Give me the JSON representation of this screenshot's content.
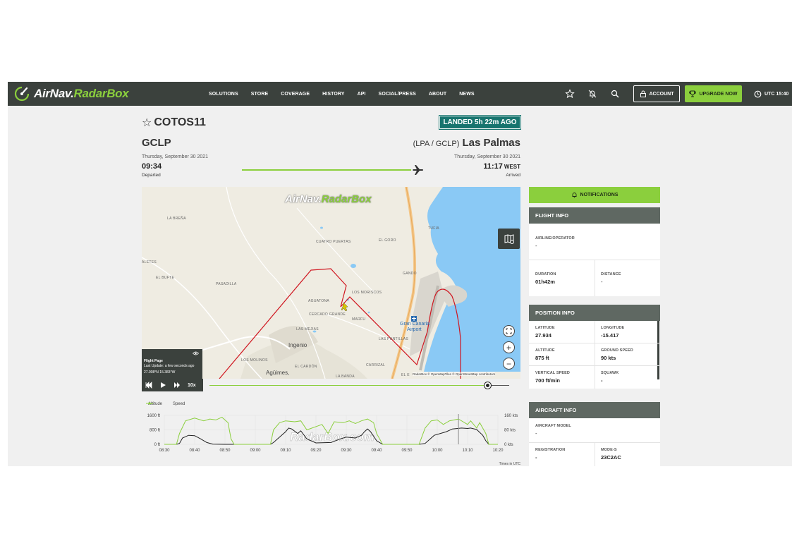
{
  "nav": {
    "brand_main": "AirNav",
    "brand_accent": "RadarBox",
    "menu": [
      "SOLUTIONS",
      "STORE",
      "COVERAGE",
      "HISTORY",
      "API",
      "SOCIAL/PRESS",
      "ABOUT",
      "NEWS"
    ],
    "account": "ACCOUNT",
    "upgrade": "UPGRADE NOW",
    "utc": "UTC 15:40"
  },
  "flight": {
    "callsign": "COTOS11",
    "status": "LANDED 5h 22m AGO",
    "origin_code": "GCLP",
    "dest_codes": "(LPA / GCLP)",
    "dest_city": "Las Palmas",
    "dep_date": "Thursday, September 30 2021",
    "arr_date": "Thursday, September 30 2021",
    "dep_time": "09:34",
    "arr_time": "11:17",
    "arr_tz": "WEST",
    "dep_state": "Departed",
    "arr_state": "Arrived"
  },
  "map": {
    "watermark_main": "AirNav",
    "watermark_accent": "RadarBox",
    "labels": [
      "LA BREÑA",
      "CUATRO PUERTAS",
      "EL GORO",
      "TUFIA",
      "ALETES",
      "EL BUFTE",
      "PASADILLA",
      "GANDO",
      "LOS MORISCOS",
      "AGUATONA",
      "CERCADO GRANDE",
      "MARFU",
      "LAS MEJIAS",
      "LAS PUNTILLAS",
      "LOS MOLINOS",
      "EL CARDÓN",
      "CARRIZAL",
      "LA BANDA",
      "EL E"
    ],
    "towns": [
      "Ingenio",
      "Agüimes,",
      "Gran Canaria",
      "Airport"
    ],
    "attribution": "RadarBox © OpenMapTiles © OpenStreetMap contributors",
    "info_title": "Flight Page",
    "info_update": "Last Update: a few seconds ago",
    "info_coords": "27.908°N 15.383°W",
    "playback_speed": "10x"
  },
  "chart_data": {
    "type": "line",
    "legend": [
      "Altitude",
      "Speed"
    ],
    "x": [
      "08:30",
      "08:40",
      "08:50",
      "09:00",
      "09:10",
      "09:20",
      "09:30",
      "09:40",
      "09:50",
      "10:00",
      "10:10",
      "10:20"
    ],
    "y_left_ticks": [
      "1600 ft",
      "800 ft",
      "0 ft"
    ],
    "y_right_ticks": [
      "160 kts",
      "80 kts",
      "0 kts"
    ],
    "y_left_range": [
      0,
      1600
    ],
    "y_right_range": [
      0,
      160
    ],
    "xlabel": "Times in UTC",
    "watermark": "RadarBox.com",
    "series": [
      {
        "name": "Altitude",
        "color": "#222222",
        "points": [
          [
            0,
            0
          ],
          [
            4,
            0
          ],
          [
            5,
            50
          ],
          [
            6,
            350
          ],
          [
            8,
            500
          ],
          [
            10,
            480
          ],
          [
            12,
            300
          ],
          [
            14,
            100
          ],
          [
            16,
            10
          ],
          [
            20,
            0
          ],
          [
            35,
            0
          ],
          [
            36,
            100
          ],
          [
            38,
            400
          ],
          [
            40,
            700
          ],
          [
            41,
            900
          ],
          [
            42,
            850
          ],
          [
            44,
            600
          ],
          [
            45,
            750
          ],
          [
            47,
            300
          ],
          [
            50,
            80
          ],
          [
            55,
            100
          ],
          [
            58,
            300
          ],
          [
            60,
            400
          ],
          [
            63,
            350
          ],
          [
            65,
            500
          ],
          [
            66,
            700
          ],
          [
            67,
            850
          ],
          [
            68,
            700
          ],
          [
            70,
            200
          ],
          [
            72,
            0
          ],
          [
            84,
            0
          ],
          [
            86,
            50
          ],
          [
            89,
            500
          ],
          [
            93,
            700
          ],
          [
            95,
            850
          ],
          [
            98,
            900
          ],
          [
            100,
            880
          ],
          [
            101,
            900
          ],
          [
            103,
            820
          ],
          [
            105,
            500
          ],
          [
            106,
            200
          ],
          [
            107,
            0
          ],
          [
            110,
            0
          ]
        ]
      },
      {
        "name": "Speed",
        "color": "#8bcf3d",
        "points": [
          [
            0,
            0
          ],
          [
            4,
            0
          ],
          [
            5,
            60
          ],
          [
            7,
            130
          ],
          [
            10,
            145
          ],
          [
            13,
            130
          ],
          [
            15,
            140
          ],
          [
            17,
            135
          ],
          [
            19,
            150
          ],
          [
            21,
            120
          ],
          [
            22,
            30
          ],
          [
            23,
            0
          ],
          [
            35,
            0
          ],
          [
            36,
            80
          ],
          [
            38,
            120
          ],
          [
            40,
            130
          ],
          [
            43,
            125
          ],
          [
            45,
            130
          ],
          [
            47,
            80
          ],
          [
            52,
            110
          ],
          [
            54,
            60
          ],
          [
            56,
            125
          ],
          [
            59,
            120
          ],
          [
            61,
            130
          ],
          [
            63,
            115
          ],
          [
            65,
            130
          ],
          [
            67,
            140
          ],
          [
            69,
            120
          ],
          [
            70,
            60
          ],
          [
            72,
            0
          ],
          [
            84,
            0
          ],
          [
            86,
            90
          ],
          [
            88,
            130
          ],
          [
            90,
            135
          ],
          [
            92,
            110
          ],
          [
            94,
            130
          ],
          [
            97,
            140
          ],
          [
            100,
            110
          ],
          [
            101,
            130
          ],
          [
            103,
            90
          ],
          [
            104,
            120
          ],
          [
            106,
            60
          ],
          [
            107,
            0
          ],
          [
            110,
            0
          ]
        ]
      }
    ]
  },
  "panel": {
    "notifications": "NOTIFICATIONS",
    "flight_info": {
      "title": "FLIGHT INFO",
      "airline_k": "AIRLINE/OPERATOR",
      "airline_v": "-",
      "duration_k": "DURATION",
      "duration_v": "01h42m",
      "distance_k": "DISTANCE",
      "distance_v": "-"
    },
    "position_info": {
      "title": "POSITION INFO",
      "lat_k": "LATITUDE",
      "lat_v": "27.934",
      "lon_k": "LONGITUDE",
      "lon_v": "-15.417",
      "alt_k": "ALTITUDE",
      "alt_v": "875 ft",
      "gs_k": "GROUND SPEED",
      "gs_v": "90 kts",
      "vs_k": "VERTICAL SPEED",
      "vs_v": "700 ft/min",
      "sq_k": "SQUAWK",
      "sq_v": "-"
    },
    "aircraft_info": {
      "title": "AIRCRAFT INFO",
      "model_k": "AIRCRAFT MODEL",
      "model_v": "-",
      "reg_k": "REGISTRATION",
      "reg_v": "-",
      "modes_k": "MODE-S",
      "modes_v": "23C2AC"
    }
  },
  "colors": {
    "brand_green": "#8bcf3d",
    "nav_dark": "#3b413d",
    "badge_teal": "#17746e",
    "track_red": "#d0151f",
    "sea_blue": "#8ac9f5"
  }
}
